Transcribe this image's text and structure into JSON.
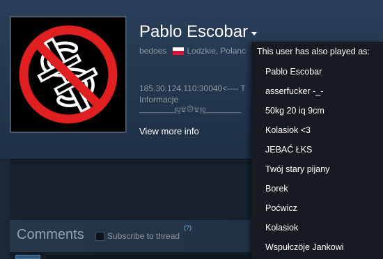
{
  "profile": {
    "persona_name": "Pablo Escobar",
    "real_name": "bedoes",
    "location": "Lodzkie, Poland",
    "location_visible": "Lodzkie, Polanc",
    "summary_line1": "185.30.124.110:30040<---- T",
    "summary_line2": "Informacje",
    "ornament": "_________ஜ۩۞۩ஜ_________",
    "view_more": "View more info",
    "flag_colors": {
      "top": "#ffffff",
      "bottom": "#dc143c"
    }
  },
  "avatar": {
    "icon": "no-dollar-sign-icon",
    "colors": {
      "ring": "#e02020",
      "symbol": "#ffffff",
      "background": "#000000"
    }
  },
  "alias_popup": {
    "title": "This user has also played as:",
    "aliases": [
      "Pablo Escobar",
      "asserfucker -_-",
      "50kg 20 iq 9cm",
      "Kolasiok <3",
      "JEBAĆ ŁKS",
      "Twój stary pijany",
      "Borek",
      "Poćwicz",
      "Kolasiok",
      "Wspułczöje Jankowi"
    ]
  },
  "comments": {
    "title": "Comments",
    "subscribe_label": "Subscribe to thread",
    "help_mark": "(?)"
  },
  "colors": {
    "background": "#1b2838",
    "popup_background": "#171a21",
    "link_blue": "#66c0f4"
  }
}
